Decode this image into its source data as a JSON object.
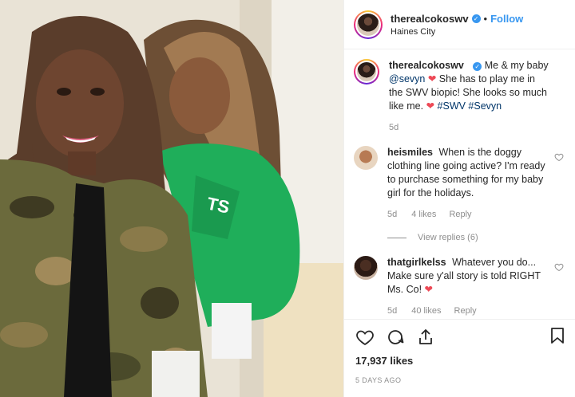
{
  "header": {
    "username": "therealcokoswv",
    "verified_mark": "✓",
    "separator": "•",
    "follow_label": "Follow",
    "location": "Haines City"
  },
  "caption": {
    "username": "therealcokoswv",
    "text_1": "Me & my baby",
    "mention": "@sevyn",
    "text_2": "She has to play me in the SWV biopic! She looks so much like me.",
    "hashtags": "#SWV #Sevyn",
    "time": "5d"
  },
  "comments": [
    {
      "username": "heismiles",
      "text": "When is the doggy clothing line going active? I'm ready to purchase something for my baby girl for the holidays.",
      "time": "5d",
      "likes": "4 likes",
      "reply": "Reply",
      "view_replies": "View replies (6)"
    },
    {
      "username": "thatgirlkelss",
      "text": "Whatever you do... Make sure y'all story is told RIGHT Ms. Co!",
      "time": "5d",
      "likes": "40 likes",
      "reply": "Reply"
    }
  ],
  "footer": {
    "likes": "17,937 likes",
    "posted": "5 DAYS AGO"
  },
  "icons": {
    "heart": "heart-icon",
    "comment": "comment-icon",
    "share": "share-icon",
    "save": "bookmark-icon"
  },
  "colors": {
    "link_blue": "#3897f0",
    "heart_red": "#ed4956",
    "mention_navy": "#003569",
    "green_top": "#1fae5a",
    "camo": "#6b6a3c"
  }
}
